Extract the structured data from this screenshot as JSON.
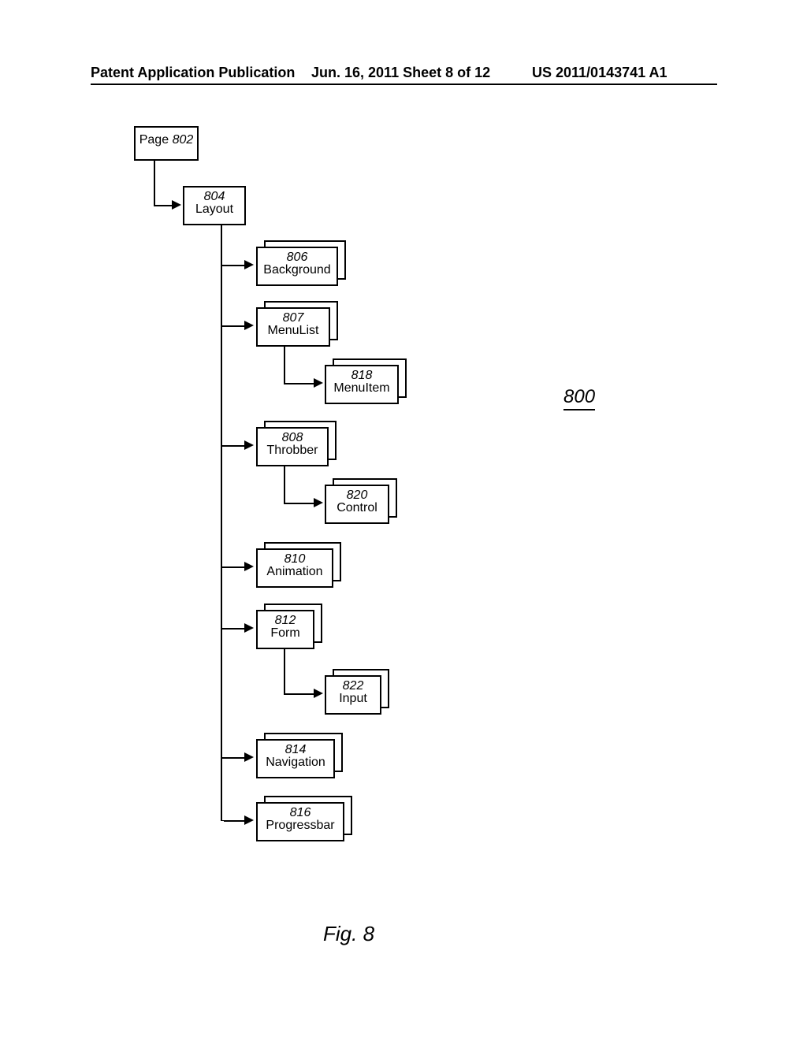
{
  "header": {
    "left": "Patent Application Publication",
    "center": "Jun. 16, 2011  Sheet 8 of 12",
    "right": "US 2011/0143741 A1"
  },
  "figure": {
    "overall_ref": "800",
    "caption": "Fig. 8",
    "nodes": {
      "page": {
        "num": "802",
        "label": "Page"
      },
      "layout": {
        "num": "804",
        "label": "Layout"
      },
      "background": {
        "num": "806",
        "label": "Background"
      },
      "menulist": {
        "num": "807",
        "label": "MenuList"
      },
      "menuitem": {
        "num": "818",
        "label": "MenuItem"
      },
      "throbber": {
        "num": "808",
        "label": "Throbber"
      },
      "control": {
        "num": "820",
        "label": "Control"
      },
      "animation": {
        "num": "810",
        "label": "Animation"
      },
      "form": {
        "num": "812",
        "label": "Form"
      },
      "input": {
        "num": "822",
        "label": "Input"
      },
      "navigation": {
        "num": "814",
        "label": "Navigation"
      },
      "progressbar": {
        "num": "816",
        "label": "Progressbar"
      }
    }
  }
}
